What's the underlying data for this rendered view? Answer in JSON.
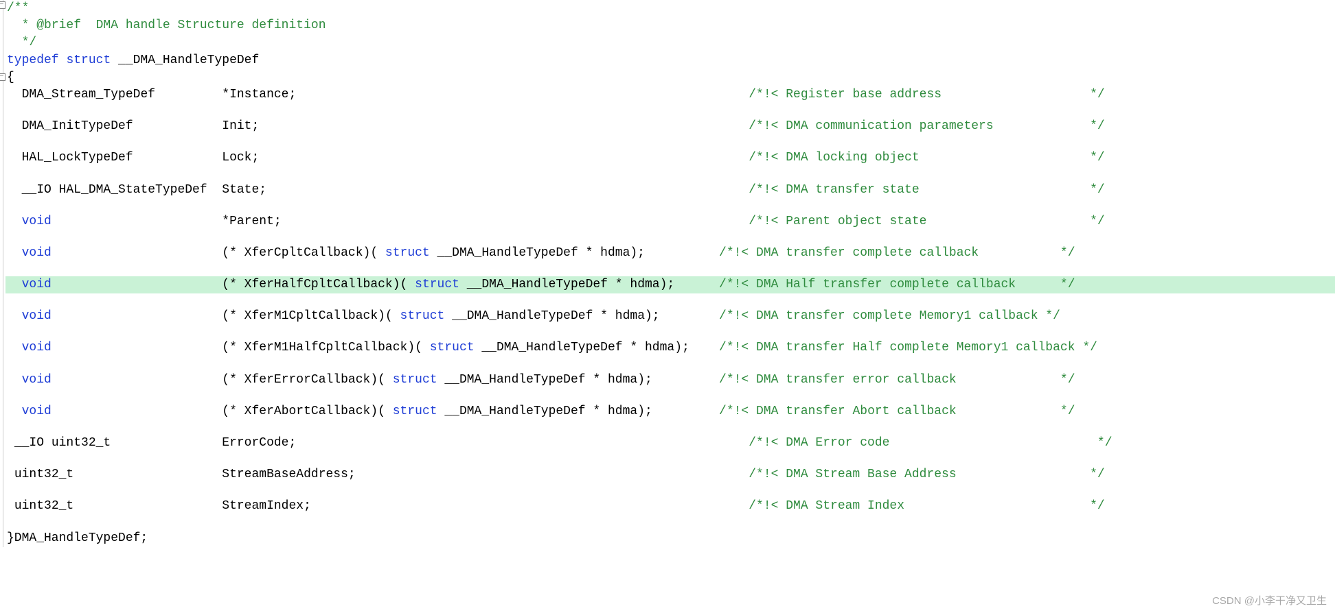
{
  "doc": {
    "comment_open": "/**",
    "comment_brief_prefix": "  * @brief",
    "comment_brief_text": "  DMA handle Structure definition",
    "comment_close": "  */",
    "typedef_kw": "typedef",
    "struct_kw": "struct",
    "typedef_name": " __DMA_HandleTypeDef",
    "brace_open": "{",
    "brace_close_name": "}DMA_HandleTypeDef;",
    "void_kw": "void"
  },
  "members": [
    {
      "indent": "  ",
      "type": "DMA_Stream_TypeDef         ",
      "decl": "*Instance;",
      "pad": "                                                             ",
      "cmt_open": "/*!< ",
      "cmt_body": "Register base address                    ",
      "cmt_close": "*/"
    },
    {
      "indent": "  ",
      "type": "DMA_InitTypeDef            ",
      "decl": "Init;",
      "pad": "                                                                  ",
      "cmt_open": "/*!< ",
      "cmt_body": "DMA communication parameters             ",
      "cmt_close": "*/"
    },
    {
      "indent": "  ",
      "type": "HAL_LockTypeDef            ",
      "decl": "Lock;",
      "pad": "                                                                  ",
      "cmt_open": "/*!< ",
      "cmt_body": "DMA locking object                       ",
      "cmt_close": "*/"
    },
    {
      "indent": "  ",
      "type": "__IO HAL_DMA_StateTypeDef  ",
      "decl": "State;",
      "pad": "                                                                 ",
      "cmt_open": "/*!< ",
      "cmt_body": "DMA transfer state                       ",
      "cmt_close": "*/"
    },
    {
      "indent": "  ",
      "type_kw": "void",
      "type_pad": "                       ",
      "decl": "*Parent;",
      "pad": "                                                               ",
      "cmt_open": "/*!< ",
      "cmt_body": "Parent object state                      ",
      "cmt_close": "*/"
    },
    {
      "indent": "  ",
      "type_kw": "void",
      "type_pad": "                       ",
      "decl_pre": "(* XferCpltCallback)( ",
      "decl_kw": "struct",
      "decl_post": " __DMA_HandleTypeDef * hdma);",
      "pad": "          ",
      "cmt_open": "/*!< ",
      "cmt_body": "DMA transfer complete callback           ",
      "cmt_close": "*/"
    },
    {
      "highlight": true,
      "indent": "  ",
      "type_kw": "void",
      "type_pad": "                       ",
      "decl_pre": "(* XferHalfCpltCallback)( ",
      "decl_kw": "struct",
      "decl_post": " __DMA_HandleTypeDef * hdma);",
      "pad": "      ",
      "cmt_open": "/*!< ",
      "cmt_body": "DMA Half transfer complete callback      ",
      "cmt_close": "*/"
    },
    {
      "indent": "  ",
      "type_kw": "void",
      "type_pad": "                       ",
      "decl_pre": "(* XferM1CpltCallback)( ",
      "decl_kw": "struct",
      "decl_post": " __DMA_HandleTypeDef * hdma);",
      "pad": "        ",
      "cmt_open": "/*!< ",
      "cmt_body": "DMA transfer complete Memory1 callback ",
      "cmt_close": "*/"
    },
    {
      "indent": "  ",
      "type_kw": "void",
      "type_pad": "                       ",
      "decl_pre": "(* XferM1HalfCpltCallback)( ",
      "decl_kw": "struct",
      "decl_post": " __DMA_HandleTypeDef * hdma);",
      "pad": "    ",
      "cmt_open": "/*!< ",
      "cmt_body": "DMA transfer Half complete Memory1 callback ",
      "cmt_close": "*/"
    },
    {
      "indent": "  ",
      "type_kw": "void",
      "type_pad": "                       ",
      "decl_pre": "(* XferErrorCallback)( ",
      "decl_kw": "struct",
      "decl_post": " __DMA_HandleTypeDef * hdma);",
      "pad": "         ",
      "cmt_open": "/*!< ",
      "cmt_body": "DMA transfer error callback              ",
      "cmt_close": "*/"
    },
    {
      "indent": "  ",
      "type_kw": "void",
      "type_pad": "                       ",
      "decl_pre": "(* XferAbortCallback)( ",
      "decl_kw": "struct",
      "decl_post": " __DMA_HandleTypeDef * hdma);",
      "pad": "         ",
      "cmt_open": "/*!< ",
      "cmt_body": "DMA transfer Abort callback              ",
      "cmt_close": "*/"
    },
    {
      "indent": " ",
      "type": "__IO uint32_t               ",
      "decl": "ErrorCode;",
      "pad": "                                                             ",
      "cmt_open": "/*!< ",
      "cmt_body": "DMA Error code                            ",
      "cmt_close": "*/"
    },
    {
      "indent": " ",
      "type": "uint32_t                    ",
      "decl": "StreamBaseAddress;",
      "pad": "                                                     ",
      "cmt_open": "/*!< ",
      "cmt_body": "DMA Stream Base Address                  ",
      "cmt_close": "*/"
    },
    {
      "indent": " ",
      "type": "uint32_t                    ",
      "decl": "StreamIndex;",
      "pad": "                                                           ",
      "cmt_open": "/*!< ",
      "cmt_body": "DMA Stream Index                         ",
      "cmt_close": "*/"
    }
  ],
  "watermark": "CSDN @小李干净又卫生"
}
